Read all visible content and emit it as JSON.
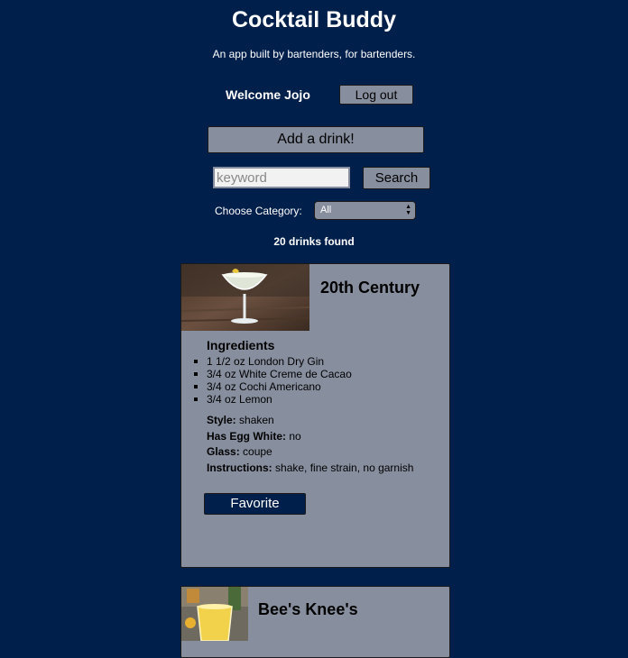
{
  "header": {
    "title": "Cocktail Buddy",
    "tagline": "An app built by bartenders, for bartenders."
  },
  "user": {
    "welcome": "Welcome Jojo",
    "logout_label": "Log out"
  },
  "actions": {
    "add_drink_label": "Add a drink!"
  },
  "search": {
    "placeholder": "keyword",
    "value": "",
    "button_label": "Search"
  },
  "filter": {
    "label": "Choose Category:",
    "selected": "All"
  },
  "results": {
    "count_text": "20 drinks found"
  },
  "drinks": [
    {
      "name": "20th Century",
      "ingredients_heading": "Ingredients",
      "ingredients": [
        "1 1/2 oz London Dry Gin",
        "3/4 oz White Creme de Cacao",
        "3/4 oz Cochi Americano",
        "3/4 oz Lemon"
      ],
      "style_label": "Style:",
      "style": "shaken",
      "egg_label": "Has Egg White:",
      "egg": "no",
      "glass_label": "Glass:",
      "glass": "coupe",
      "instructions_label": "Instructions:",
      "instructions": "shake, fine strain, no garnish",
      "favorite_label": "Favorite"
    },
    {
      "name": "Bee's Knee's"
    }
  ],
  "colors": {
    "background": "#001f4b",
    "card": "#878e9e",
    "button": "#878e9e",
    "favorite_button": "#001f4b",
    "text_light": "#ffffff",
    "text_dark": "#000000"
  }
}
